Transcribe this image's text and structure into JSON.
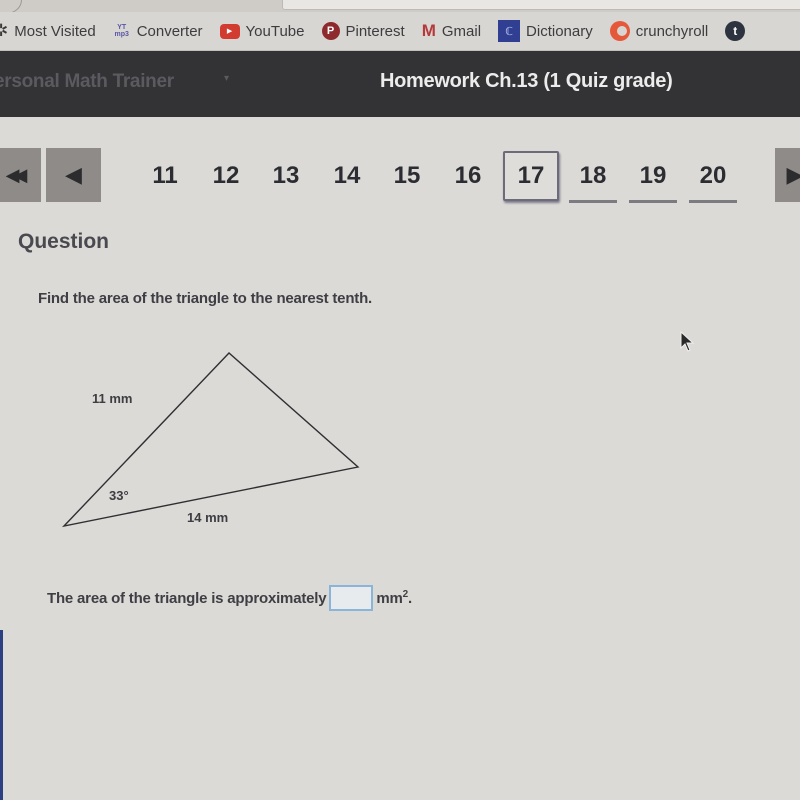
{
  "browser": {
    "bookmarks": [
      {
        "label": "Most Visited",
        "icon": "gear-icon"
      },
      {
        "label": "Converter",
        "icon": "yt-mp3-icon",
        "icon_text_top": "YT",
        "icon_text_bottom": "mp3"
      },
      {
        "label": "YouTube",
        "icon": "youtube-icon",
        "icon_text": "▶"
      },
      {
        "label": "Pinterest",
        "icon": "pinterest-icon",
        "icon_text": "P"
      },
      {
        "label": "Gmail",
        "icon": "gmail-icon",
        "icon_text": "M"
      },
      {
        "label": "Dictionary",
        "icon": "dictionary-icon",
        "icon_text": "ℂ"
      },
      {
        "label": "crunchyroll",
        "icon": "crunchyroll-icon"
      },
      {
        "label": "",
        "icon": "tumblr-icon",
        "icon_text": "t"
      }
    ]
  },
  "header": {
    "app_name": "ersonal Math Trainer",
    "app_caret": "▾",
    "assignment_title": "Homework Ch.13 (1 Quiz grade)"
  },
  "pager": {
    "first_icon": "◀◀",
    "prev_icon": "◀",
    "next_icon": "▶",
    "pages": [
      {
        "label": "11",
        "state": "visited"
      },
      {
        "label": "12",
        "state": "visited"
      },
      {
        "label": "13",
        "state": "visited"
      },
      {
        "label": "14",
        "state": "visited"
      },
      {
        "label": "15",
        "state": "visited"
      },
      {
        "label": "16",
        "state": "visited"
      },
      {
        "label": "17",
        "state": "current"
      },
      {
        "label": "18",
        "state": "pending"
      },
      {
        "label": "19",
        "state": "pending"
      },
      {
        "label": "20",
        "state": "pending"
      }
    ]
  },
  "question": {
    "heading": "Question",
    "prompt": "Find the area of the triangle to the nearest tenth.",
    "figure": {
      "side_a_label": "11 mm",
      "side_b_label": "14 mm",
      "angle_label": "33°",
      "side_a": 11,
      "side_b": 14,
      "angle_deg": 33
    },
    "answer_prefix": "The area of the triangle is approximately",
    "answer_value": "",
    "answer_unit": "mm",
    "answer_unit_exp": "2",
    "answer_suffix": "."
  },
  "colors": {
    "header_bg": "#333336",
    "page_bg": "#dcdad6",
    "input_border": "#8ab4d8"
  }
}
